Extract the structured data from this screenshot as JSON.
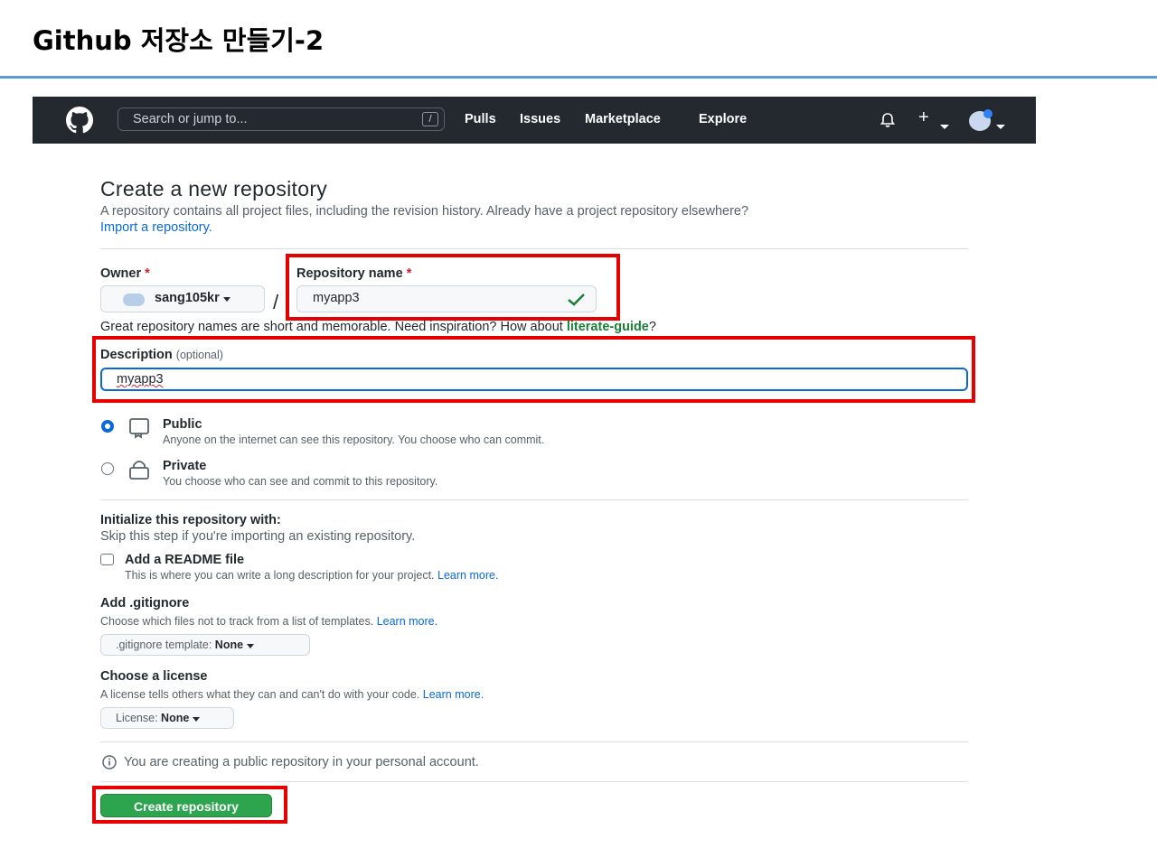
{
  "slide": {
    "title": "Github 저장소 만들기-2"
  },
  "header": {
    "search_placeholder": "Search or jump to...",
    "search_shortcut": "/",
    "nav": [
      "Pulls",
      "Issues",
      "Marketplace",
      "Explore"
    ],
    "plus_label": "+"
  },
  "page": {
    "heading": "Create a new repository",
    "subtitle": "A repository contains all project files, including the revision history. Already have a project repository elsewhere?",
    "import_link": "Import a repository."
  },
  "owner": {
    "label": "Owner",
    "required_mark": "*",
    "value": "sang105kr"
  },
  "separator": "/",
  "repo_name": {
    "label": "Repository name",
    "required_mark": "*",
    "value": "myapp3"
  },
  "hint": {
    "text": "Great repository names are short and memorable. Need inspiration? How about ",
    "suggestion": "literate-guide",
    "suffix": "?"
  },
  "description": {
    "label": "Description",
    "optional": "(optional)",
    "value": "myapp3"
  },
  "visibility": {
    "public": {
      "title": "Public",
      "desc": "Anyone on the internet can see this repository. You choose who can commit.",
      "selected": true
    },
    "private": {
      "title": "Private",
      "desc": "You choose who can see and commit to this repository.",
      "selected": false
    }
  },
  "init": {
    "title": "Initialize this repository with:",
    "subtitle": "Skip this step if you're importing an existing repository.",
    "readme_label": "Add a README file",
    "readme_desc": "This is where you can write a long description for your project.",
    "readme_checked": false,
    "learn_more": "Learn more."
  },
  "gitignore": {
    "title": "Add .gitignore",
    "desc": "Choose which files not to track from a list of templates.",
    "learn_more": "Learn more.",
    "select_prefix": ".gitignore template:",
    "select_value": "None"
  },
  "license": {
    "title": "Choose a license",
    "desc": "A license tells others what they can and can't do with your code.",
    "learn_more": "Learn more.",
    "select_prefix": "License:",
    "select_value": "None"
  },
  "notice": "You are creating a public repository in your personal account.",
  "submit_label": "Create repository",
  "colors": {
    "highlight": "#e60000",
    "primary_button": "#2da44e",
    "link": "#0969da",
    "header_bg": "#24292f"
  }
}
